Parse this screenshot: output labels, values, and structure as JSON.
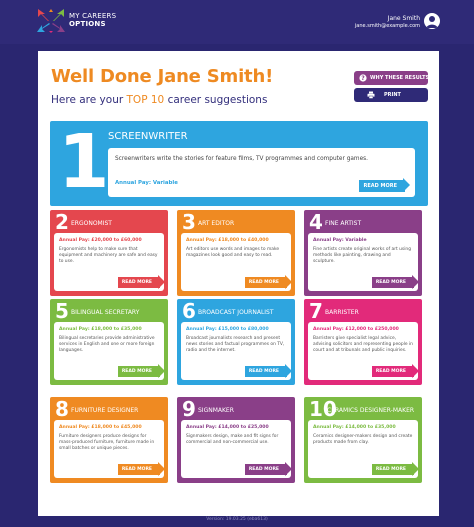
{
  "header": {
    "logo_line1": "MY CAREERS",
    "logo_line2": "OPTIONS",
    "user_name": "Jane Smith",
    "user_email": "jane.smith@example.com"
  },
  "page": {
    "greeting": "Well Done Jane Smith!",
    "subtitle_prefix": "Here are your ",
    "subtitle_highlight": "TOP 10",
    "subtitle_suffix": " career suggestions",
    "why_button": "WHY THESE RESULTS?",
    "print_button": "PRINT"
  },
  "careers": [
    {
      "rank": "1",
      "title": "SCREENWRITER",
      "pay": "Annual Pay: Variable",
      "description": "Screenwriters write the stories for feature films, TV programmes and computer games.",
      "more": "READ MORE",
      "color": "#2ea5df"
    },
    {
      "rank": "2",
      "title": "ERGONOMIST",
      "pay": "Annual Pay: £20,000 to £60,000",
      "description": "Ergonomists help to make sure that equipment and machinery are safe and easy to use.",
      "more": "READ MORE",
      "color": "#e4474e"
    },
    {
      "rank": "3",
      "title": "ART EDITOR",
      "pay": "Annual Pay: £18,000 to £40,000",
      "description": "Art editors use words and images to make magazines look good and easy to read.",
      "more": "READ MORE",
      "color": "#ef8a22"
    },
    {
      "rank": "4",
      "title": "FINE ARTIST",
      "pay": "Annual Pay: Variable",
      "description": "Fine artists create original works of art using methods like painting, drawing and sculpture.",
      "more": "READ MORE",
      "color": "#8a3f88"
    },
    {
      "rank": "5",
      "title": "BILINGUAL SECRETARY",
      "pay": "Annual Pay: £18,000 to £35,000",
      "description": "Bilingual secretaries provide administrative services in English and one or more foreign languages.",
      "more": "READ MORE",
      "color": "#7cbb42"
    },
    {
      "rank": "6",
      "title": "BROADCAST JOURNALIST",
      "pay": "Annual Pay: £15,000 to £80,000",
      "description": "Broadcast journalists research and present news stories and factual programmes on TV, radio and the internet.",
      "more": "READ MORE",
      "color": "#2ea5df"
    },
    {
      "rank": "7",
      "title": "BARRISTER",
      "pay": "Annual Pay: £12,000 to £250,000",
      "description": "Barristers give specialist legal advice, advising solicitors and representing people in court and at tribunals and public inquiries.",
      "more": "READ MORE",
      "color": "#e22a7a"
    },
    {
      "rank": "8",
      "title": "FURNITURE DESIGNER",
      "pay": "Annual Pay: £18,000 to £45,000",
      "description": "Furniture designers produce designs for mass-produced furniture, furniture made in small batches or unique pieces.",
      "more": "READ MORE",
      "color": "#ef8a22"
    },
    {
      "rank": "9",
      "title": "SIGNMAKER",
      "pay": "Annual Pay: £14,000 to £25,000",
      "description": "Signmakers design, make and fit signs for commercial and non-commercial use.",
      "more": "READ MORE",
      "color": "#8a3f88"
    },
    {
      "rank": "10",
      "title": "CERAMICS DESIGNER-MAKER",
      "pay": "Annual Pay: £14,000 to £35,000",
      "description": "Ceramics designer-makers design and create products made from clay.",
      "more": "READ MORE",
      "color": "#7cbb42"
    }
  ],
  "footer": {
    "version": "Version: 19.03.25 (eba613)"
  },
  "icons": {
    "logo": "colorful-arrows-logo",
    "avatar": "user-avatar-icon",
    "why": "question-icon",
    "print": "printer-icon",
    "more": "arrow-right-icon"
  }
}
